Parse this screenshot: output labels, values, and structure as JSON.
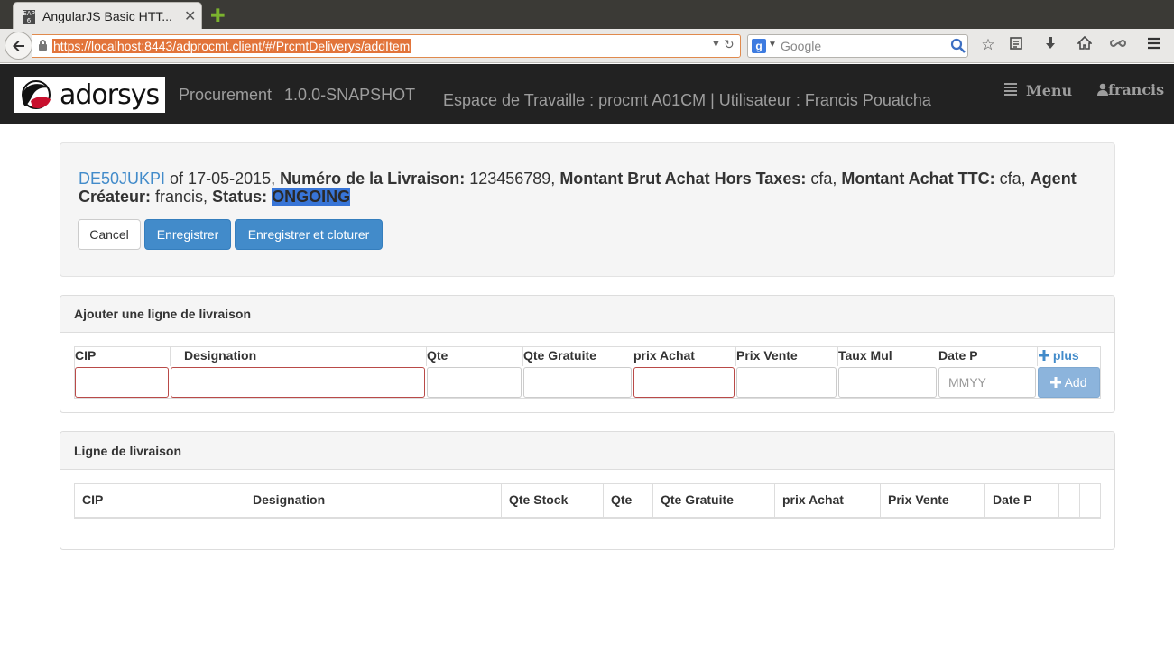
{
  "browser": {
    "tab_title": "AngularJS Basic HTT...",
    "tab_favicon": "EAP 6",
    "url": "https://localhost:8443/adprocmt.client/#/PrcmtDeliverys/addItem",
    "search_placeholder": "Google",
    "search_engine_letter": "g"
  },
  "app": {
    "logo_text": "adorsys",
    "brand": "Procurement",
    "version": "1.0.0-SNAPSHOT",
    "workspace": "Espace de Travaille : procmt A01CM | Utilisateur : Francis Pouatcha",
    "menu_label": "Menu",
    "user_label": "francis",
    "icons": {
      "menu": "list-icon",
      "user": "user-icon"
    }
  },
  "delivery": {
    "number_link": "DE50JUKPI",
    "of_text": " of 17-05-2015, ",
    "numero_label": "Numéro de la Livraison:",
    "numero_value": " 123456789, ",
    "brut_label": "Montant Brut Achat Hors Taxes:",
    "brut_value": " cfa, ",
    "ttc_label": "Montant Achat TTC:",
    "ttc_value": " cfa, ",
    "agent_label": "Agent Créateur:",
    "agent_value": " francis, ",
    "status_label": "Status:",
    "status_value": "ONGOING",
    "status_highlight_color": "#3875d7"
  },
  "actions": {
    "cancel": "Cancel",
    "save": "Enregistrer",
    "save_close": "Enregistrer et cloturer"
  },
  "add_panel": {
    "title": "Ajouter une ligne de livraison",
    "headers": [
      "CIP",
      "Designation",
      "Qte",
      "Qte Gratuite",
      "prix Achat",
      "Prix Vente",
      "Taux Mul",
      "Date P"
    ],
    "plus_label": "plus",
    "date_placeholder": "MMYY",
    "add_label": "Add"
  },
  "list_panel": {
    "title": "Ligne de livraison",
    "headers": [
      "CIP",
      "Designation",
      "Qte Stock",
      "Qte",
      "Qte Gratuite",
      "prix Achat",
      "Prix Vente",
      "Date P"
    ]
  },
  "colors": {
    "navbar_bg": "#222222",
    "primary": "#428bca",
    "required_border": "#b94a48",
    "url_highlight": "#e2743a"
  }
}
